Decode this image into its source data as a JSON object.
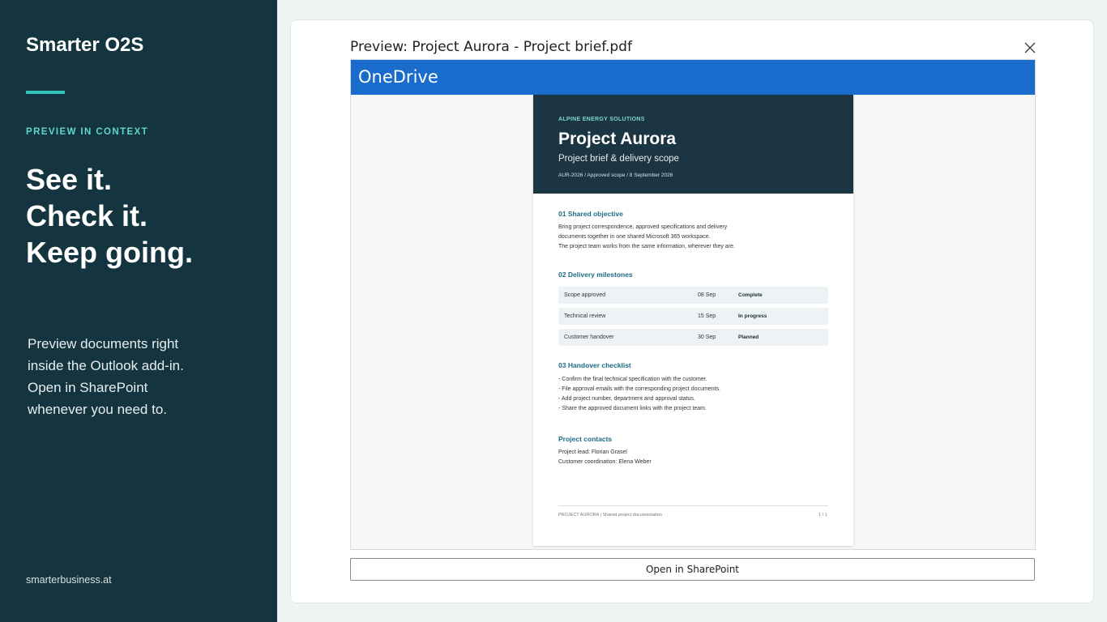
{
  "sidebar": {
    "brand": "Smarter O2S",
    "eyebrow": "PREVIEW IN CONTEXT",
    "headline": [
      "See it.",
      "Check it.",
      "Keep going."
    ],
    "description": [
      "Preview documents right",
      "inside the Outlook add-in.",
      "Open in SharePoint",
      "whenever you need to."
    ],
    "footer_link": "smarterbusiness.at",
    "accent_color": "#2ec4b6"
  },
  "preview": {
    "title": "Preview: Project Aurora - Project brief.pdf",
    "close_icon": "close-icon",
    "viewer_title": "OneDrive",
    "viewer_color": "#1a6ccc",
    "open_button": "Open in SharePoint"
  },
  "document": {
    "company": "ALPINE ENERGY SOLUTIONS",
    "title": "Project Aurora",
    "subtitle": "Project brief & delivery scope",
    "meta": "AUR-2026  /  Approved scope  /  8 September 2026",
    "section1": {
      "heading": "01  Shared objective",
      "lines": [
        "Bring project correspondence, approved specifications and delivery",
        "documents together in one shared Microsoft 365 workspace.",
        "The project team works from the same information, wherever they are."
      ]
    },
    "section2": {
      "heading": "02  Delivery milestones",
      "milestones": [
        {
          "name": "Scope approved",
          "date": "08 Sep",
          "status": "Complete"
        },
        {
          "name": "Technical review",
          "date": "15 Sep",
          "status": "In progress"
        },
        {
          "name": "Customer handover",
          "date": "30 Sep",
          "status": "Planned"
        }
      ]
    },
    "section3": {
      "heading": "03  Handover checklist",
      "lines": [
        "- Confirm the final technical specification with the customer.",
        "- File approval emails with the corresponding project documents.",
        "- Add project number, department and approval status.",
        "- Share the approved document links with the project team."
      ]
    },
    "contacts": {
      "heading": "Project contacts",
      "lines": [
        "Project lead: Florian Grasel",
        "Customer coordination: Elena Weber"
      ]
    },
    "footer_left": "PROJECT AURORA  |  Shared project documentation",
    "footer_right": "1 / 1"
  }
}
